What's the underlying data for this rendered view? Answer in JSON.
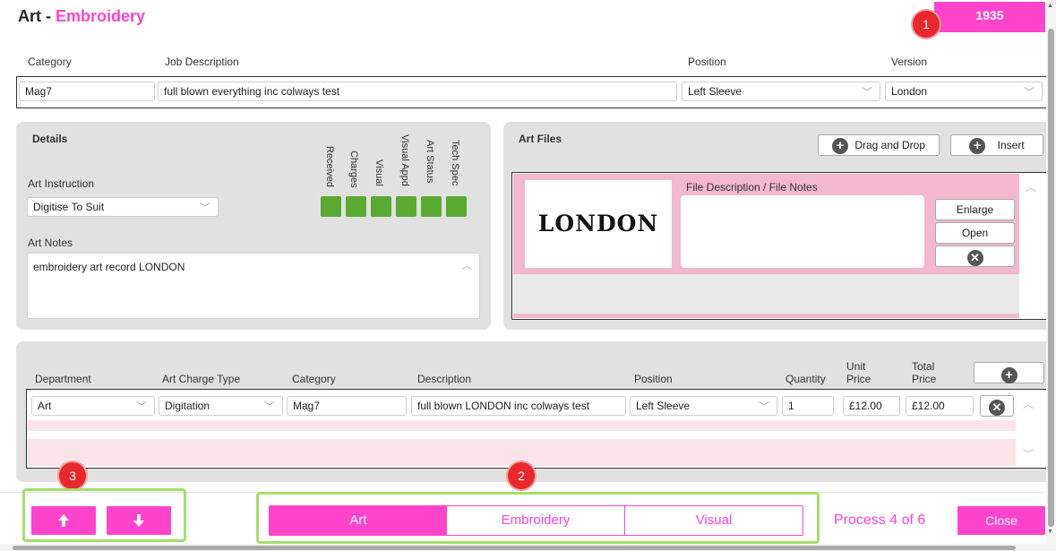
{
  "header": {
    "title_art": "Art",
    "title_sep": "-",
    "title_type": "Embroidery",
    "job_number": "1935"
  },
  "badges": [
    "1",
    "2",
    "3"
  ],
  "top_fields": {
    "category_label": "Category",
    "category_value": "Mag7",
    "job_description_label": "Job Description",
    "job_description_value": "full blown everything inc colways test",
    "position_label": "Position",
    "position_value": "Left Sleeve",
    "version_label": "Version",
    "version_value": "London"
  },
  "details": {
    "title": "Details",
    "status_labels": [
      "Received",
      "Charges",
      "Visual",
      "Visual Appd",
      "Art Status",
      "Tech Spec"
    ],
    "status_color": "#5aaa32",
    "art_instruction_label": "Art Instruction",
    "art_instruction_value": "Digitise To Suit",
    "art_notes_label": "Art Notes",
    "art_notes_value": "embroidery art record LONDON"
  },
  "art_files": {
    "title": "Art Files",
    "drag_drop_label": "Drag and Drop",
    "insert_label": "Insert",
    "file_desc_label": "File Description / File Notes",
    "thumbnail_text": "LONDON",
    "enlarge_label": "Enlarge",
    "open_label": "Open"
  },
  "charges": {
    "columns": {
      "department": "Department",
      "art_charge_type": "Art Charge Type",
      "category": "Category",
      "description": "Description",
      "position": "Position",
      "quantity": "Quantity",
      "unit_price": "Unit Price",
      "total_price": "Total Price"
    },
    "rows": [
      {
        "department": "Art",
        "art_charge_type": "Digitation",
        "category": "Mag7",
        "description": "full blown LONDON inc colways test",
        "position": "Left Sleeve",
        "quantity": "1",
        "unit_price": "£12.00",
        "total_price": "£12.00"
      }
    ]
  },
  "footer": {
    "up_icon": "arrow-up-icon",
    "down_icon": "arrow-down-icon",
    "tabs": [
      {
        "label": "Art",
        "active": true
      },
      {
        "label": "Embroidery",
        "active": false
      },
      {
        "label": "Visual",
        "active": false
      }
    ],
    "process_text": "Process 4 of 6",
    "close_label": "Close"
  },
  "colors": {
    "accent": "#ff44cc",
    "badge": "#e8282c",
    "highlight_frame": "#a6df68",
    "panel_bg": "#e1e1e1",
    "file_row_bg": "#f2b8cd"
  }
}
